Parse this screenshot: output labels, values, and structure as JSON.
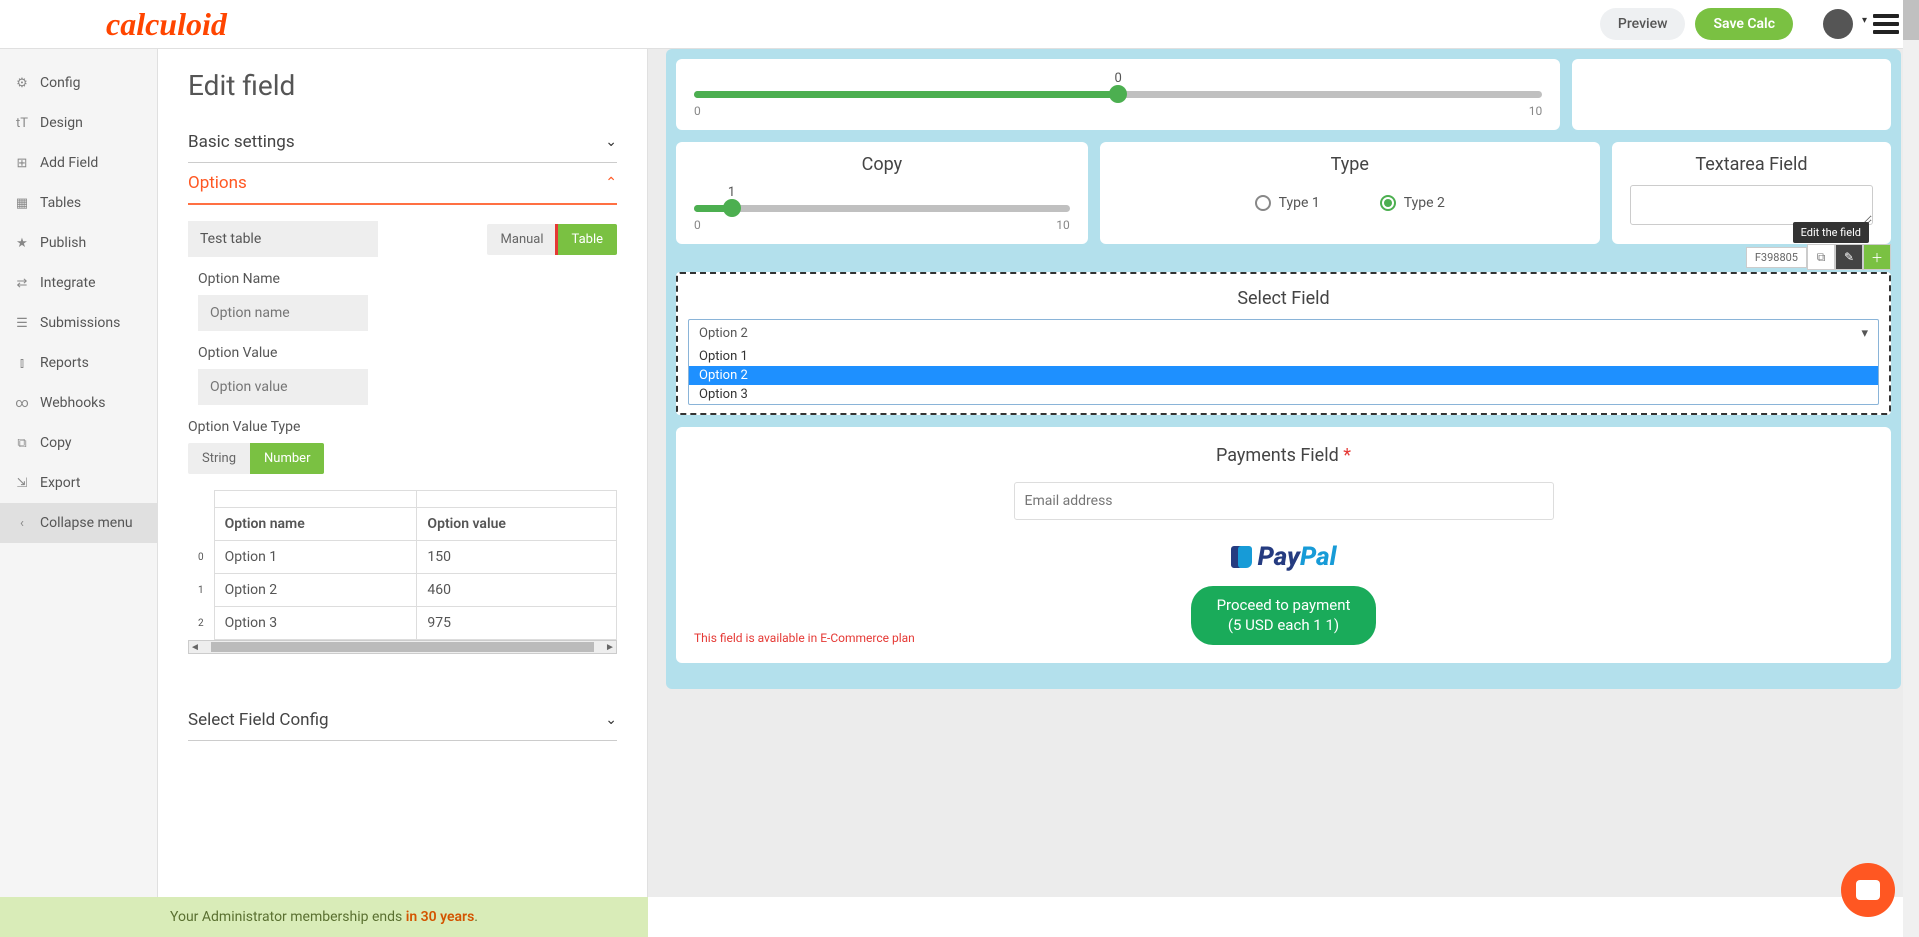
{
  "header": {
    "logo": "calculoid",
    "preview": "Preview",
    "save": "Save Calc"
  },
  "sidebar": {
    "items": [
      {
        "icon": "⚙",
        "label": "Config"
      },
      {
        "icon": "tT",
        "label": "Design"
      },
      {
        "icon": "⊞",
        "label": "Add Field"
      },
      {
        "icon": "▦",
        "label": "Tables"
      },
      {
        "icon": "★",
        "label": "Publish"
      },
      {
        "icon": "⇄",
        "label": "Integrate"
      },
      {
        "icon": "☰",
        "label": "Submissions"
      },
      {
        "icon": "⫾",
        "label": "Reports"
      },
      {
        "icon": "∞",
        "label": "Webhooks"
      },
      {
        "icon": "⧉",
        "label": "Copy"
      },
      {
        "icon": "⇲",
        "label": "Export"
      },
      {
        "icon": "‹",
        "label": "Collapse menu"
      }
    ]
  },
  "edit": {
    "title": "Edit field",
    "basic": "Basic settings",
    "options": "Options",
    "table_name": "Test table",
    "manual": "Manual",
    "table": "Table",
    "opt_name_label": "Option Name",
    "opt_name_ph": "Option name",
    "opt_val_label": "Option Value",
    "opt_val_ph": "Option value",
    "opt_type_label": "Option Value Type",
    "string": "String",
    "number": "Number",
    "th_name": "Option name",
    "th_val": "Option value",
    "rows": [
      {
        "idx": "0",
        "name": "Option 1",
        "val": "150"
      },
      {
        "idx": "1",
        "name": "Option 2",
        "val": "460"
      },
      {
        "idx": "2",
        "name": "Option 3",
        "val": "975"
      }
    ],
    "select_config": "Select Field Config"
  },
  "canvas": {
    "slider_top": {
      "val": "0",
      "min": "0",
      "max": "10",
      "pct": 50
    },
    "copy": {
      "title": "Copy",
      "val": "1",
      "min": "0",
      "max": "10",
      "pct": 10
    },
    "type": {
      "title": "Type",
      "opt1": "Type 1",
      "opt2": "Type 2"
    },
    "textarea": {
      "title": "Textarea Field"
    },
    "select": {
      "title": "Select Field",
      "current": "Option 2",
      "opts": [
        "Option 1",
        "Option 2",
        "Option 3"
      ],
      "id": "F398805",
      "tooltip": "Edit the field"
    },
    "payments": {
      "title": "Payments Field",
      "email_ph": "Email address",
      "paypal_a": "Pay",
      "paypal_b": "Pal",
      "btn1": "Proceed to payment",
      "btn2": "(5 USD each 1 1)",
      "note": "This field is available in E-Commerce plan"
    }
  },
  "footer": {
    "text": "Your Administrator membership ends ",
    "years": "in 30 years",
    "dot": "."
  }
}
